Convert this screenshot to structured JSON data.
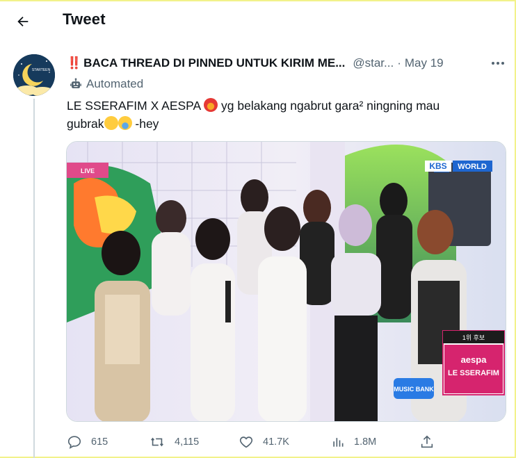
{
  "header": {
    "title": "Tweet"
  },
  "tweet": {
    "warning_mark": "‼️",
    "display_name": "BACA THREAD DI PINNED UNTUK KIRIM ME...",
    "handle": "@star...",
    "separator": "·",
    "date": "May 19",
    "automated_label": "Automated",
    "text_line1_a": "LE SSERAFIM X AESPA",
    "text_line1_b": "yg belakang ngabrut gara² ningning mau",
    "text_line2_a": "gubrak",
    "text_line2_b": "-hey",
    "image": {
      "channel_logo_a": "KBS",
      "channel_logo_b": "WORLD",
      "rank_badge": "1위 후보",
      "candidate_1": "aespa",
      "candidate_2": "LE SSERAFIM",
      "live_tag": "LIVE",
      "show_logo": "MUSIC BANK"
    }
  },
  "actions": {
    "replies": "615",
    "retweets": "4,115",
    "likes": "41.7K",
    "views": "1.8M"
  },
  "colors": {
    "text": "#0f1419",
    "secondary": "#536471",
    "border": "#cfd9de",
    "warning": "#e0245e",
    "kbs_blue": "#1e66d0",
    "candidate_pink": "#d6246e"
  },
  "icons": {
    "back": "arrow-left-icon",
    "more": "more-dots-icon",
    "automated": "robot-icon",
    "reply": "reply-bubble-icon",
    "retweet": "retweet-icon",
    "like": "heart-icon",
    "views": "bar-chart-icon",
    "share": "share-upload-icon"
  }
}
